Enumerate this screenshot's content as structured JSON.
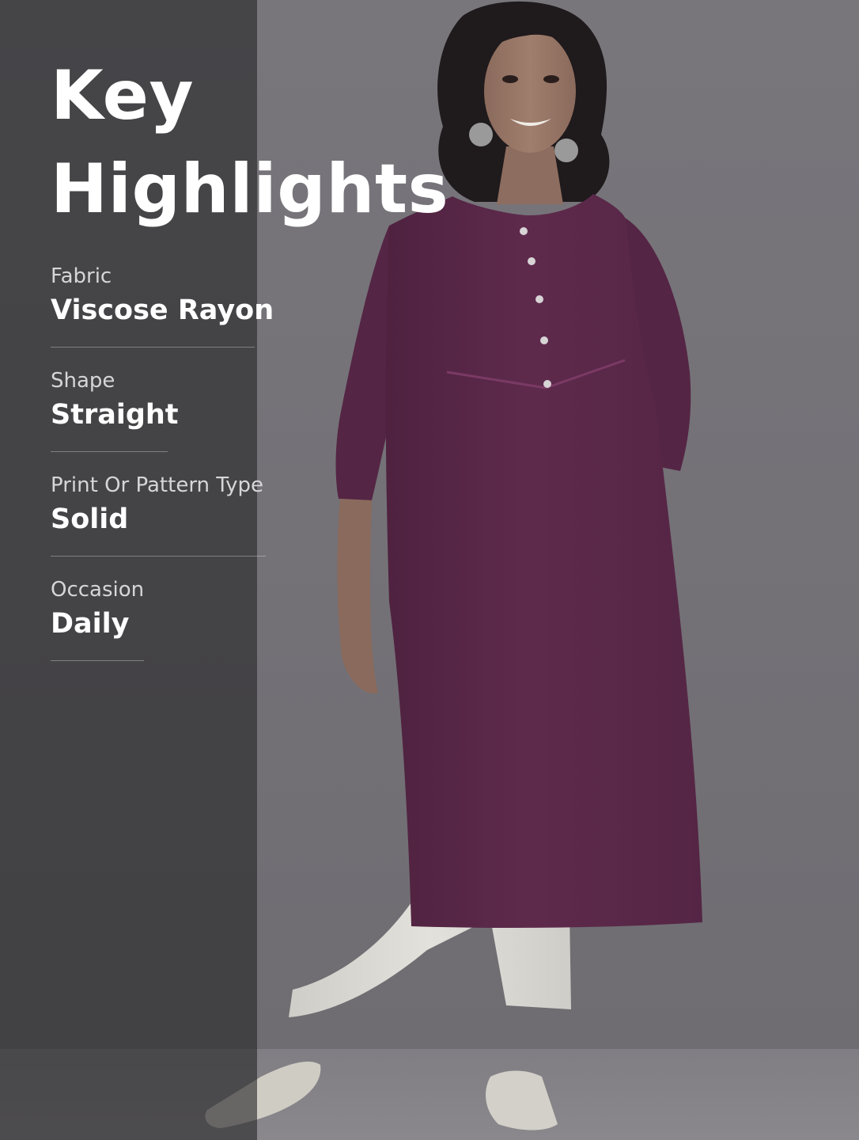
{
  "title": {
    "line1": "Key",
    "line2": "Highlights"
  },
  "highlights": [
    {
      "label": "Fabric",
      "value": "Viscose Rayon"
    },
    {
      "label": "Shape",
      "value": "Straight"
    },
    {
      "label": "Print Or Pattern Type",
      "value": "Solid"
    },
    {
      "label": "Occasion",
      "value": "Daily"
    }
  ],
  "colors": {
    "kurta": "#5e2a4c",
    "pants": "#dedcd6",
    "background": "#737176",
    "panel_overlay": "rgba(38,38,40,0.62)",
    "text_primary": "#ffffff",
    "text_secondary": "#d6d5d8"
  }
}
